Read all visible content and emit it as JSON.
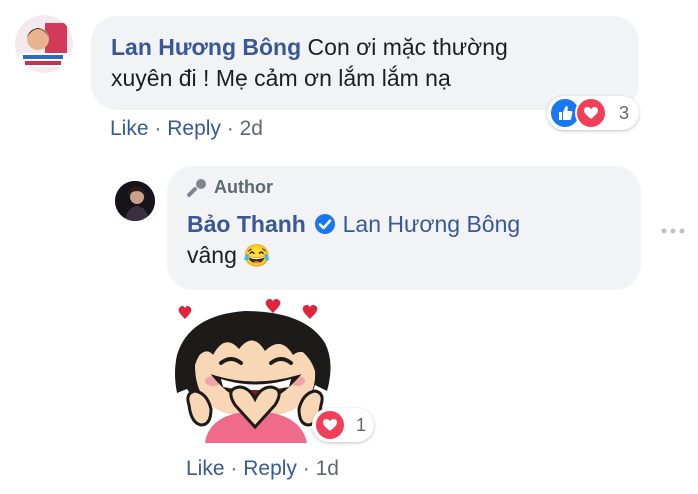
{
  "comment1": {
    "author": "Lan Hương Bông",
    "text_line1": "Con ơi mặc thường",
    "text_line2": "xuyên đi ! Mẹ cảm ơn lắm lắm nạ",
    "reaction_count": "3",
    "actions": {
      "like": "Like",
      "reply": "Reply",
      "sep": "·",
      "time": "2d"
    }
  },
  "reply": {
    "badge": "Author",
    "author": "Bảo Thanh",
    "mention": "Lan Hương Bông",
    "text": "vâng",
    "emoji": "😂",
    "sticker_reaction_count": "1",
    "actions": {
      "like": "Like",
      "reply": "Reply",
      "sep": "·",
      "time": "1d"
    }
  },
  "colors": {
    "link": "#385898",
    "bubble": "#f2f3f5",
    "like_blue": "#1877f2",
    "love_red": "#f33e58",
    "verified": "#1877f2"
  }
}
